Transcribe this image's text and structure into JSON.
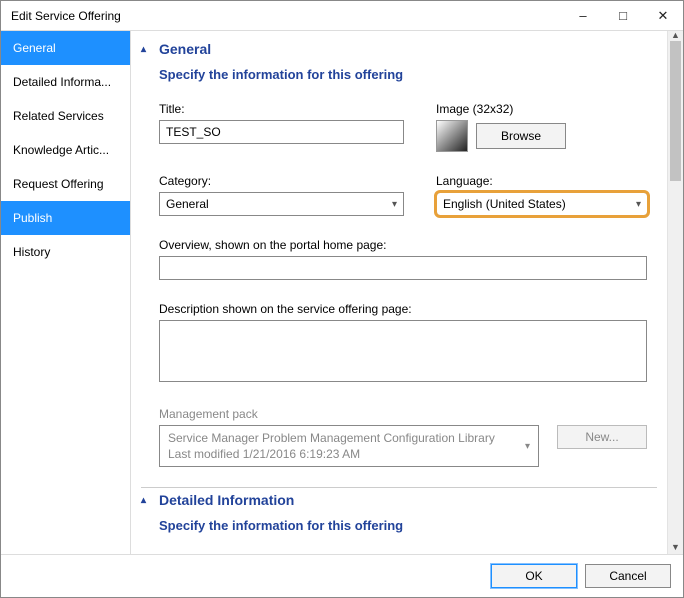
{
  "window": {
    "title": "Edit Service Offering"
  },
  "sidebar": {
    "items": [
      {
        "label": "General"
      },
      {
        "label": "Detailed Informa..."
      },
      {
        "label": "Related Services"
      },
      {
        "label": "Knowledge Artic..."
      },
      {
        "label": "Request Offering"
      },
      {
        "label": "Publish"
      },
      {
        "label": "History"
      }
    ]
  },
  "general": {
    "header": "General",
    "subheader": "Specify the information for this offering",
    "title_label": "Title:",
    "title_value": "TEST_SO",
    "image_label": "Image (32x32)",
    "browse_label": "Browse",
    "category_label": "Category:",
    "category_value": "General",
    "language_label": "Language:",
    "language_value": "English (United States)",
    "overview_label": "Overview, shown on the portal home page:",
    "overview_value": "",
    "description_label": "Description shown on the service offering page:",
    "description_value": "",
    "mp_label": "Management pack",
    "mp_name": "Service Manager Problem Management Configuration Library",
    "mp_modified": "Last modified  1/21/2016 6:19:23 AM",
    "new_label": "New..."
  },
  "detailed": {
    "header": "Detailed Information",
    "subheader": "Specify the information for this offering"
  },
  "footer": {
    "ok": "OK",
    "cancel": "Cancel"
  }
}
